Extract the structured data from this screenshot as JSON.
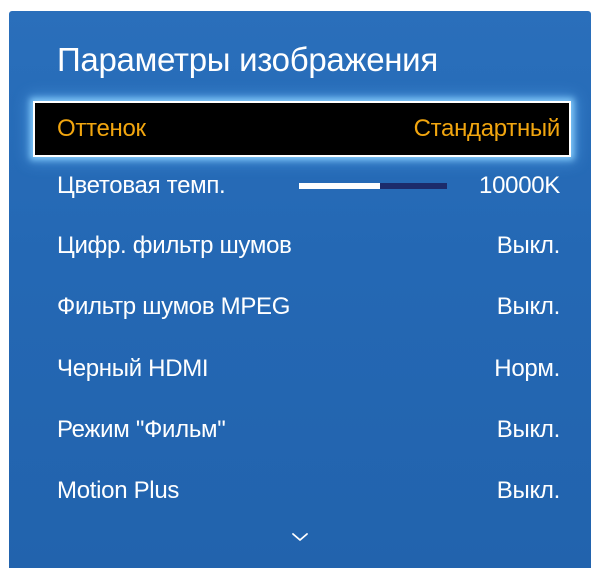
{
  "menu": {
    "title": "Параметры изображения",
    "items": [
      {
        "label": "Оттенок",
        "value": "Стандартный"
      },
      {
        "label": "Цветовая темп.",
        "value": "10000K",
        "slider_level": 0.55
      },
      {
        "label": "Цифр. фильтр шумов",
        "value": "Выкл."
      },
      {
        "label": "Фильтр шумов MPEG",
        "value": "Выкл."
      },
      {
        "label": "Черный HDMI",
        "value": "Норм."
      },
      {
        "label": "Режим \"Фильм\"",
        "value": "Выкл."
      },
      {
        "label": "Motion Plus",
        "value": "Выкл."
      }
    ],
    "scroll_icon": "chevron-down-icon"
  },
  "colors": {
    "panel_background": "#2468b4",
    "selected_background": "#000000",
    "selected_text": "#f2a60f",
    "focus_glow": "#8cd2ff",
    "slider_track": "#1c2b6b",
    "slider_fill": "#ffffff",
    "text": "#ffffff"
  }
}
